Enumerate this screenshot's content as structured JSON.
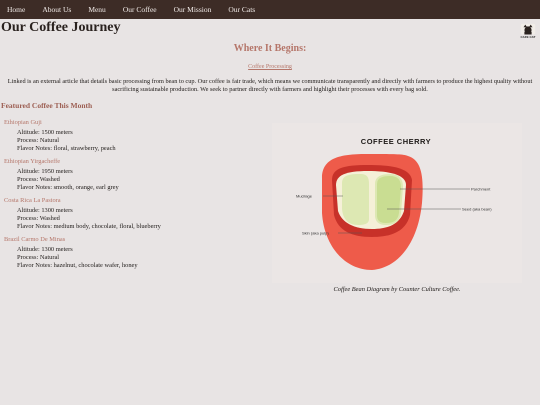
{
  "nav": {
    "items": [
      "Home",
      "About Us",
      "Menu",
      "Our Coffee",
      "Our Mission",
      "Our Cats"
    ]
  },
  "header": {
    "title": "Our Coffee Journey",
    "logo_text": "CAFE CAT"
  },
  "intro_section": {
    "heading": "Where It Begins:",
    "link": "Coffee Processing",
    "text": "Linked is an external article that details basic processing from bean to cup. Our coffee is fair trade, which means we communicate transparently and directly with farmers to produce the highest quality without sacrificing sustainable production. We seek to partner directly with farmers and highlight their processes with every bag sold."
  },
  "featured": {
    "heading": "Featured Coffee This Month",
    "coffees": [
      {
        "name": "Ethiopian Guji",
        "altitude": "Altitude: 1500 meters",
        "process": "Process: Natural",
        "notes": "Flavor Notes: floral, strawberry, peach"
      },
      {
        "name": "Ethiopian Yirgacheffe",
        "altitude": "Altitude: 1950 meters",
        "process": "Process: Washed",
        "notes": "Flavor Notes: smooth, orange, earl grey"
      },
      {
        "name": "Costa Rica La Pastora",
        "altitude": "Altitude: 1300 meters",
        "process": "Process: Washed",
        "notes": "Flavor Notes: medium body, chocolate, floral, blueberry"
      },
      {
        "name": "Brazil Carmo De Minas",
        "altitude": "Altitude: 1300 meters",
        "process": "Process: Natural",
        "notes": "Flavor Notes: hazelnut, chocolate wafer, honey"
      }
    ]
  },
  "diagram": {
    "title": "COFFEE CHERRY",
    "labels": {
      "parchment": "Parchment",
      "mucilage": "Mucilage",
      "seed": "Seed (aka bean)",
      "skin": "Skin (aka pulp)"
    },
    "caption": "Coffee Bean Diagram by Counter Culture Coffee."
  },
  "colors": {
    "navbar": "#3d2c26",
    "accent": "#b5766a",
    "background": "#e8e4e4",
    "cherry_skin": "#ee5b4a",
    "cherry_dark": "#c73129",
    "bean": "#dde8b3"
  }
}
